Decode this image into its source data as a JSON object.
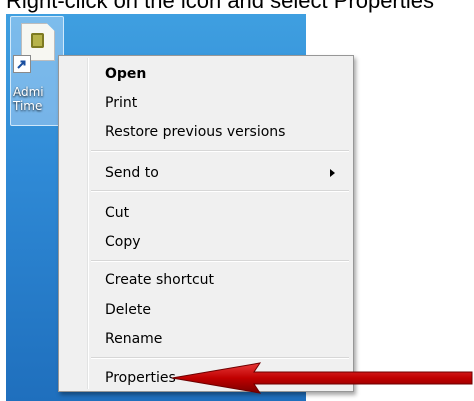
{
  "caption": "Right-click on the icon and select Properties",
  "desktop_icon": {
    "label_line1": "Admi",
    "label_line2": "Time"
  },
  "context_menu": {
    "items": [
      {
        "label": "Open",
        "bold": true
      },
      {
        "label": "Print"
      },
      {
        "label": "Restore previous versions"
      },
      {
        "label": "Send to",
        "submenu": true
      },
      {
        "label": "Cut"
      },
      {
        "label": "Copy"
      },
      {
        "label": "Create shortcut"
      },
      {
        "label": "Delete"
      },
      {
        "label": "Rename"
      },
      {
        "label": "Properties"
      }
    ]
  },
  "colors": {
    "desktop": "#2f8ad6",
    "menu_bg": "#f0f0f0",
    "annotation_arrow": "#c00000"
  }
}
